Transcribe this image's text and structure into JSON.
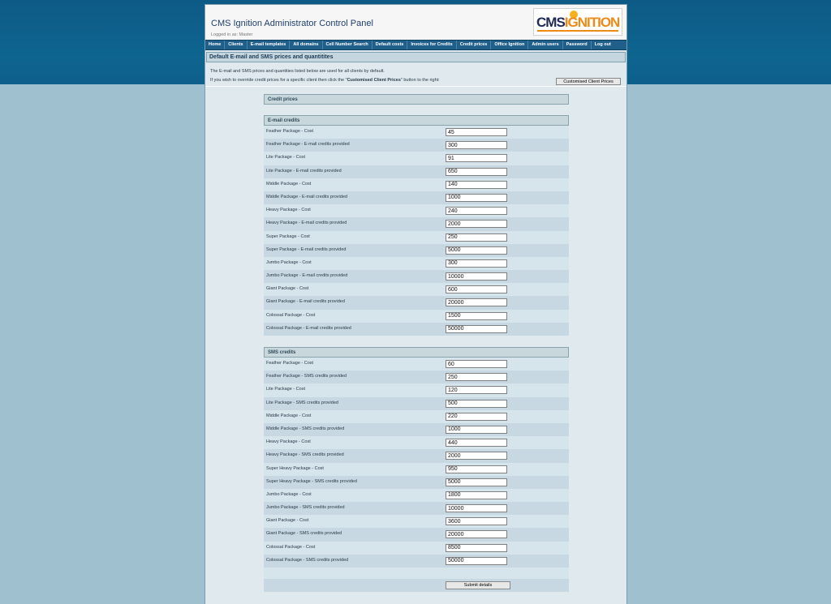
{
  "header": {
    "title": "CMS Ignition Administrator Control Panel",
    "logged_in": "Logged in as: Master",
    "logo": {
      "left": "CMS",
      "right": "IGNITION"
    }
  },
  "nav": [
    "Home",
    "Clients",
    "E-mail templates",
    "All domains",
    "Cell Number Search",
    "Default costs",
    "Invoices for Credits",
    "Credit prices",
    "Office Ignition",
    "Admin users",
    "Password",
    "Log out"
  ],
  "section_title": "Default E-mail and SMS prices and quantitites",
  "intro": {
    "line1": "The E-mail and SMS prices and quantities listed below are used for all clients by default.",
    "line2_prefix": "If you wish to override credit prices for a specific client then click the \"",
    "line2_bold": "Customised Client Prices",
    "line2_suffix": "\" button to the right:",
    "button": "Customised Client Prices"
  },
  "credit_prices_heading": "Credit prices",
  "email": {
    "heading": "E-mail credits",
    "rows": [
      {
        "label": "Feather Package - Cost",
        "value": "45"
      },
      {
        "label": "Feather Package - E-mail credits provided",
        "value": "300"
      },
      {
        "label": "Lite Package - Cost",
        "value": "91"
      },
      {
        "label": "Lite Package - E-mail credits provided",
        "value": "650"
      },
      {
        "label": "Middle Package - Cost",
        "value": "140"
      },
      {
        "label": "Middle Package - E-mail credits provided",
        "value": "1000"
      },
      {
        "label": "Heavy Package - Cost",
        "value": "240"
      },
      {
        "label": "Heavy Package - E-mail credits provided",
        "value": "2000"
      },
      {
        "label": "Super Package - Cost",
        "value": "250"
      },
      {
        "label": "Super Package - E-mail credits provided",
        "value": "5000"
      },
      {
        "label": "Jumbo Package - Cost",
        "value": "300"
      },
      {
        "label": "Jumbo Package - E-mail credits provided",
        "value": "10000"
      },
      {
        "label": "Giant Package - Cost",
        "value": "600"
      },
      {
        "label": "Giant Package - E-mail credits provided",
        "value": "20000"
      },
      {
        "label": "Colossal Package - Cost",
        "value": "1500"
      },
      {
        "label": "Colossal Package - E-mail credits provided",
        "value": "50000"
      }
    ]
  },
  "sms": {
    "heading": "SMS credits",
    "rows": [
      {
        "label": "Feather Package - Cost",
        "value": "60"
      },
      {
        "label": "Feather Package - SMS credits provided",
        "value": "250"
      },
      {
        "label": "Lite Package - Cost",
        "value": "120"
      },
      {
        "label": "Lite Package - SMS credits provided",
        "value": "500"
      },
      {
        "label": "Middle Package - Cost",
        "value": "220"
      },
      {
        "label": "Middle Package - SMS credits provided",
        "value": "1000"
      },
      {
        "label": "Heavy Package - Cost",
        "value": "440"
      },
      {
        "label": "Heavy Package - SMS credits provided",
        "value": "2000"
      },
      {
        "label": "Super Heavy Package - Cost",
        "value": "950"
      },
      {
        "label": "Super Heavy Package - SMS credits provided",
        "value": "5000"
      },
      {
        "label": "Jumbo Package - Cost",
        "value": "1800"
      },
      {
        "label": "Jumbo Package - SMS credits provided",
        "value": "10000"
      },
      {
        "label": "Giant Package - Cost",
        "value": "3600"
      },
      {
        "label": "Giant Package - SMS credits provided",
        "value": "20000"
      },
      {
        "label": "Colossal Package - Cost",
        "value": "8500"
      },
      {
        "label": "Colossal Package - SMS credits provided",
        "value": "50000"
      }
    ]
  },
  "submit_label": "Submit details"
}
